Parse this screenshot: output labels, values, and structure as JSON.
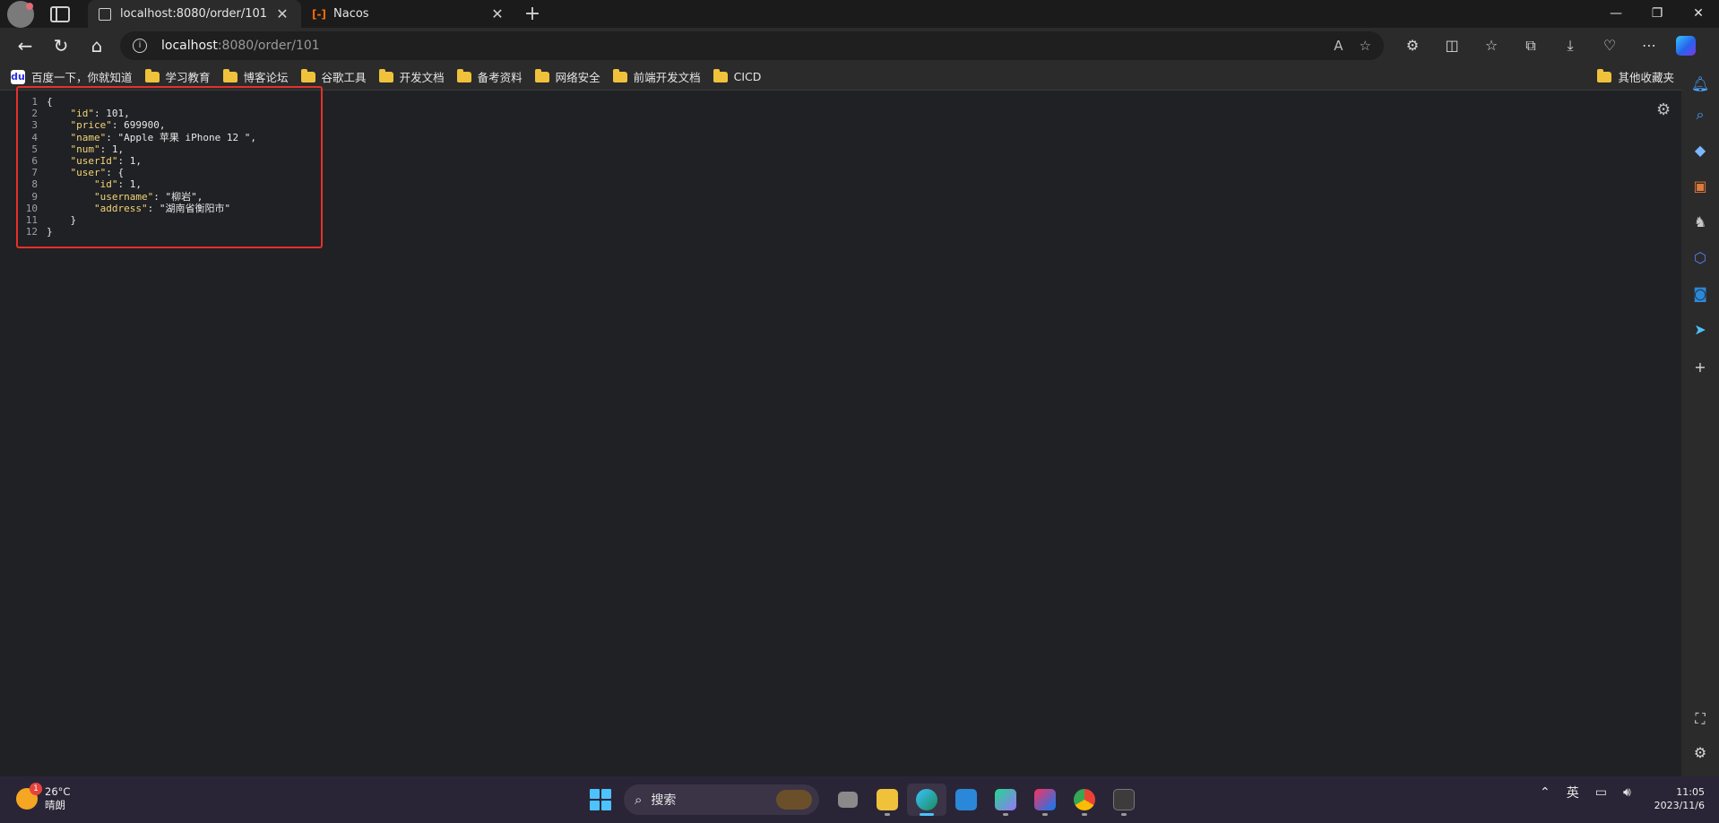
{
  "tabs": [
    {
      "title": "localhost:8080/order/101",
      "icon": "doc-icon"
    },
    {
      "title": "Nacos",
      "icon": "nacos-icon"
    }
  ],
  "address": {
    "host": "localhost",
    "rest": ":8080/order/101"
  },
  "bookmarks": [
    "百度一下，你就知道",
    "学习教育",
    "博客论坛",
    "谷歌工具",
    "开发文档",
    "备考资料",
    "网络安全",
    "前端开发文档",
    "CICD"
  ],
  "other_bookmarks": "其他收藏夹",
  "json_lines": [
    {
      "n": "1",
      "text": "{"
    },
    {
      "n": "2",
      "text": "    \"id\": 101,"
    },
    {
      "n": "3",
      "text": "    \"price\": 699900,"
    },
    {
      "n": "4",
      "text": "    \"name\": \"Apple 苹果 iPhone 12 \","
    },
    {
      "n": "5",
      "text": "    \"num\": 1,"
    },
    {
      "n": "6",
      "text": "    \"userId\": 1,"
    },
    {
      "n": "7",
      "text": "    \"user\": {"
    },
    {
      "n": "8",
      "text": "        \"id\": 1,"
    },
    {
      "n": "9",
      "text": "        \"username\": \"柳岩\","
    },
    {
      "n": "10",
      "text": "        \"address\": \"湖南省衡阳市\""
    },
    {
      "n": "11",
      "text": "    }"
    },
    {
      "n": "12",
      "text": "}"
    }
  ],
  "weather": {
    "temp": "26°C",
    "desc": "晴朗",
    "badge": "1"
  },
  "search": {
    "placeholder": "搜索"
  },
  "clock": {
    "time": "11:05",
    "date": "2023/11/6"
  },
  "tray": {
    "ime": "英"
  },
  "colors": {
    "json_key": "#f2d478",
    "json_string": "#ff8d5c",
    "json_number": "#c6d48c",
    "highlight": "#e5312b"
  }
}
